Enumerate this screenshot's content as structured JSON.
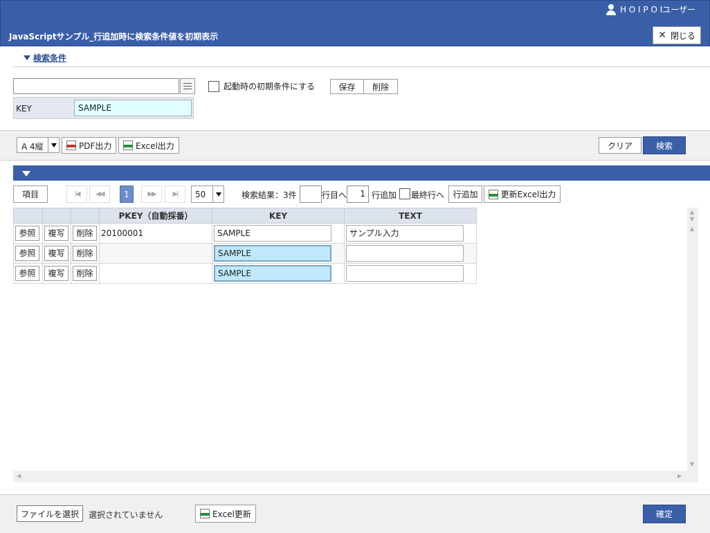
{
  "header": {
    "user_name": "H O I P O Iユーザー",
    "title": "JavaScriptサンプル_行追加時に検索条件値を初期表示",
    "close_label": "閉じる"
  },
  "search": {
    "toggle_label": "検索条件",
    "condition_value": "",
    "init_check_label": "起動時の初期条件にする",
    "save_label": "保存",
    "delete_label": "削除",
    "key_label": "KEY",
    "key_value": "SAMPLE"
  },
  "toolbar": {
    "paper_size": "A 4縦",
    "pdf_label": "PDF出力",
    "excel_label": "Excel出力",
    "clear_label": "クリア",
    "search_label": "検索"
  },
  "pager": {
    "columns_label": "項目",
    "current_page": "1",
    "page_size": "50",
    "result_text": "検索結果：3件",
    "goto_row_value": "",
    "goto_row_label": "行目へ",
    "add_count": "1",
    "add_row_label": "行追加",
    "last_row_label": "最終行へ",
    "add_row_button": "行追加",
    "update_excel_label": "更新Excel出力"
  },
  "grid": {
    "columns": [
      "",
      "",
      "",
      "PKEY（自動採番）",
      "KEY",
      "TEXT"
    ],
    "ref_label": "参照",
    "copy_label": "複写",
    "delete_label": "削除",
    "rows": [
      {
        "pkey": "20100001",
        "key": "SAMPLE",
        "text": "サンプル入力"
      },
      {
        "pkey": "",
        "key": "SAMPLE",
        "text": ""
      },
      {
        "pkey": "",
        "key": "SAMPLE",
        "text": ""
      }
    ]
  },
  "footer": {
    "file_button": "ファイルを選択",
    "file_status": "選択されていません",
    "excel_update_label": "Excel更新",
    "confirm_label": "確定"
  },
  "colors": {
    "primary": "#3a5fa8",
    "key_field_bg": "#e0ffff",
    "highlight_cell_bg": "#bfe9fb",
    "header_cell_bg": "#dde3ec"
  }
}
